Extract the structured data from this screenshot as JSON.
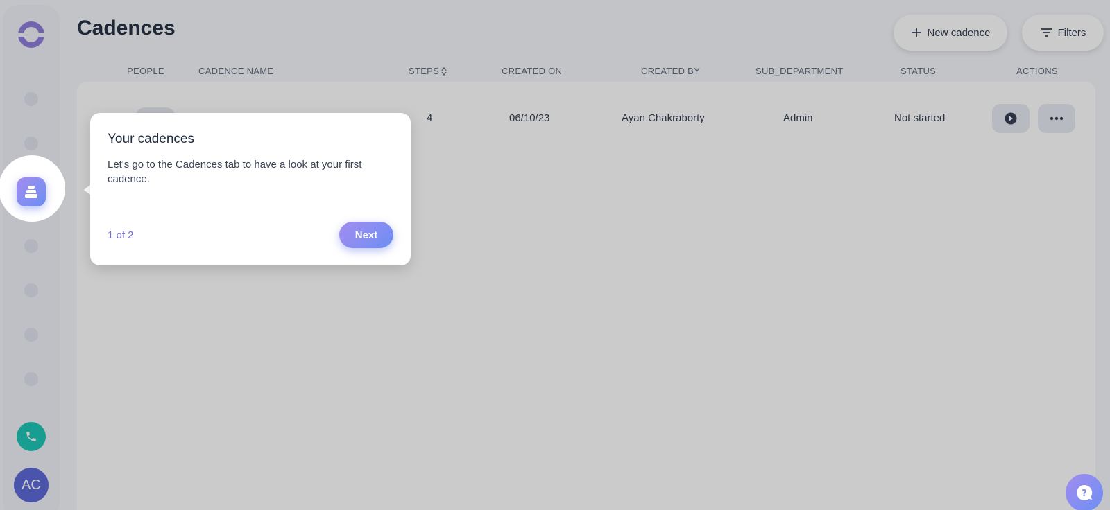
{
  "page": {
    "title": "Cadences"
  },
  "header": {
    "new_cadence_label": "New cadence",
    "filters_label": "Filters"
  },
  "table": {
    "columns": [
      "PEOPLE",
      "CADENCE NAME",
      "STEPS",
      "CREATED ON",
      "CREATED BY",
      "SUB_DEPARTMENT",
      "STATUS",
      "ACTIONS"
    ],
    "rows": [
      {
        "steps": "4",
        "created_on": "06/10/23",
        "created_by": "Ayan Chakraborty",
        "sub_department": "Admin",
        "status": "Not started"
      }
    ]
  },
  "tooltip": {
    "title": "Your cadences",
    "body": "Let's go to the Cadences tab to have a look at your first cadence.",
    "step": "1 of 2",
    "next_label": "Next"
  },
  "user": {
    "initials": "AC"
  },
  "icons": {
    "logo": "logo-icon",
    "cadences": "cadences-icon",
    "phone": "phone-icon",
    "plus": "plus-icon",
    "filter": "filter-icon",
    "play": "play-icon",
    "more": "more-icon",
    "help": "help-icon"
  },
  "colors": {
    "accent": "#6d8ff2",
    "accent_2": "#a38cf0",
    "phone": "#16c5b4",
    "avatar": "#5865d6"
  }
}
